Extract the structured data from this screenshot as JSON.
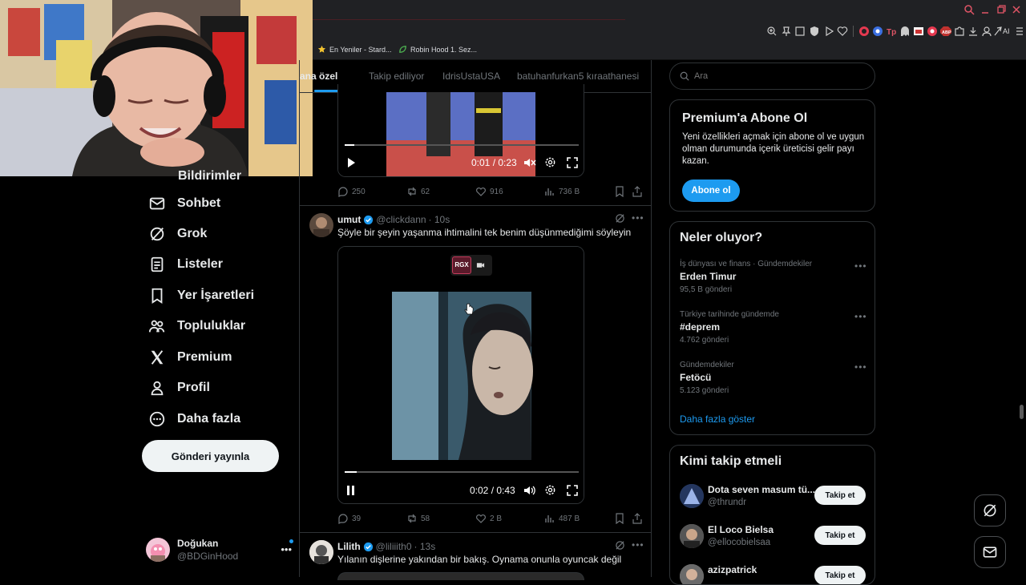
{
  "browser": {
    "bookmarks": [
      {
        "label": "En Yeniler - Stard..."
      },
      {
        "label": "Robin Hood 1. Sez..."
      }
    ],
    "ext_ai": "AI"
  },
  "sidebar": {
    "partial_item": "Bildirimler",
    "items": [
      {
        "label": "Sohbet",
        "icon": "mail-icon"
      },
      {
        "label": "Grok",
        "icon": "grok-icon"
      },
      {
        "label": "Listeler",
        "icon": "list-icon"
      },
      {
        "label": "Yer İşaretleri",
        "icon": "bookmark-icon"
      },
      {
        "label": "Topluluklar",
        "icon": "communities-icon"
      },
      {
        "label": "Premium",
        "icon": "x-logo-icon"
      },
      {
        "label": "Profil",
        "icon": "person-icon"
      },
      {
        "label": "Daha fazla",
        "icon": "more-circle-icon"
      }
    ],
    "post_button": "Gönderi yayınla",
    "account": {
      "name": "Doğukan",
      "handle": "@BDGinHood"
    }
  },
  "feed": {
    "tabs": [
      "Sana özel",
      "Takip ediliyor",
      "IdrisUstaUSA",
      "batuhanfurkan5 kıraathanesi"
    ],
    "post1": {
      "video_time": "0:01 / 0:23",
      "progress": 0.04,
      "replies": "250",
      "reposts": "62",
      "likes": "916",
      "views": "736 B"
    },
    "post2": {
      "author": "umut",
      "handle": "@clickdann",
      "time": "· 10s",
      "text": "Şöyle bir şeyin yaşanma ihtimalini tek benim düşünmediğimi söyleyin",
      "overlay_badge": "RGX",
      "video_time": "0:02 / 0:43",
      "progress": 0.05,
      "replies": "39",
      "reposts": "58",
      "likes": "2 B",
      "views": "487 B"
    },
    "post3": {
      "author": "Lilith",
      "handle": "@liliiith0",
      "time": "· 13s",
      "text": "Yılanın dişlerine yakından bir bakış. Oynama onunla oyuncak değil"
    }
  },
  "right": {
    "search_placeholder": "Ara",
    "premium": {
      "title": "Premium'a Abone Ol",
      "body": "Yeni özellikleri açmak için abone ol ve uygun olman durumunda içerik üreticisi gelir payı kazan.",
      "button": "Abone ol"
    },
    "trends": {
      "title": "Neler oluyor?",
      "items": [
        {
          "meta": "İş dünyası ve finans · Gündemdekiler",
          "name": "Erden Timur",
          "count": "95,5 B gönderi"
        },
        {
          "meta": "Türkiye tarihinde gündemde",
          "name": "#deprem",
          "count": "4.762 gönderi"
        },
        {
          "meta": "Gündemdekiler",
          "name": "Fetöcü",
          "count": "5.123 gönderi"
        }
      ],
      "more": "Daha fazla göster"
    },
    "follow": {
      "title": "Kimi takip etmeli",
      "button": "Takip et",
      "items": [
        {
          "name": "Dota seven masum tü...",
          "handle": "@thrundr"
        },
        {
          "name": "El Loco Bielsa",
          "handle": "@ellocobielsaa"
        },
        {
          "name": "azizpatrick",
          "handle": ""
        }
      ]
    }
  },
  "colors": {
    "accent": "#1d9bf0",
    "background": "#000000",
    "border": "#2f3336",
    "muted": "#71767b"
  }
}
